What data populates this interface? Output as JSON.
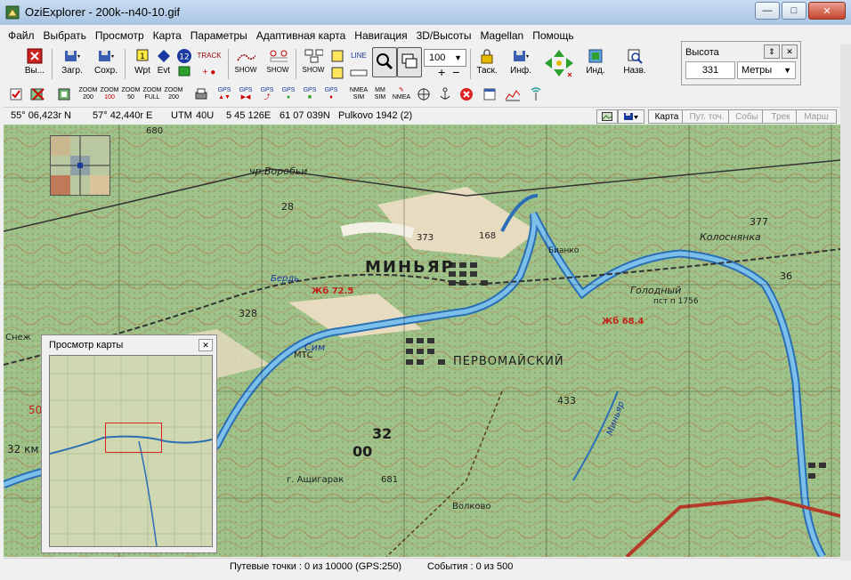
{
  "window": {
    "title": "OziExplorer - 200k--n40-10.gif"
  },
  "menu": [
    "Файл",
    "Выбрать",
    "Просмотр",
    "Карта",
    "Параметры",
    "Адаптивная карта",
    "Навигация",
    "3D/Высоты",
    "Magellan",
    "Помощь"
  ],
  "toolbar": {
    "exit_label": "Вы...",
    "load_label": "Загр.",
    "save_label": "Сохр.",
    "wpt_label": "Wpt",
    "evt_label": "Evt",
    "track_label": "TRACK",
    "show1_label": "SHOW",
    "show2_label": "SHOW",
    "show3_label": "SHOW",
    "line_label": "LINE",
    "zoom_value": "100",
    "task_label": "Таск.",
    "info_label": "Инф.",
    "ind_label": "Инд.",
    "name_label": "Назв.",
    "num12": "12",
    "num1": "1"
  },
  "altitude": {
    "title": "Высота",
    "value": "331",
    "unit": "Метры"
  },
  "toolbar2": {
    "zoom200": [
      "ZOOM",
      "200"
    ],
    "zoom100": [
      "ZOOM",
      "100"
    ],
    "zoom50": [
      "ZOOM",
      "50"
    ],
    "zoomfull": [
      "ZOOM",
      "FULL"
    ],
    "zoom200b": [
      "ZOOM",
      "200"
    ],
    "gps1": "GPS",
    "gps2": "GPS",
    "gps3": "GPS",
    "gps4": "GPS",
    "gps5": "GPS",
    "gps6": "GPS",
    "nmea_sim": [
      "NMEA",
      "SIM"
    ],
    "mm_sim": [
      "MM",
      "SIM"
    ],
    "nmea": "NMEA"
  },
  "coords": {
    "lat": "55° 06,423r N",
    "lon": "57° 42,440r E",
    "utm": "UTM",
    "zone": "40U",
    "easting": "5 45 126E",
    "northing": "61 07 039N",
    "datum": "Pulkovo 1942 (2)"
  },
  "coord_buttons": [
    "Карта",
    "Пут. точ.",
    "Собы",
    "Трек",
    "Марш"
  ],
  "map_labels": {
    "town1": "МИНЬЯР",
    "town2": "ПЕРВОМАЙСКИЙ",
    "river1": "Сим",
    "river2": "Бердь",
    "river3": "Миньяр",
    "settle1": "чр.Воробьи",
    "settle2": "Колоснянка",
    "settle3": "Голодный",
    "settle4": "Волково",
    "settle5": "г. Ащигарак",
    "settle6": "Бианко",
    "elev1": "328",
    "elev2": "433",
    "elev3": "377",
    "elev4": "373",
    "elev5": "681",
    "elev6": "680",
    "elev7": "168",
    "grid1": "32",
    "grid2": "28",
    "grid3": "00",
    "grid4": "36",
    "km": "32 км",
    "jb": "Жб 72.5",
    "jb2": "Жб 68.4",
    "mtg": "МТС",
    "pst": "пст п 1756",
    "left1": "Снеж",
    "left2": "50"
  },
  "preview": {
    "title": "Просмотр карты"
  },
  "status": {
    "waypoints": "Путевые точки : 0 из 10000  (GPS:250)",
    "events": "События : 0 из 500"
  }
}
